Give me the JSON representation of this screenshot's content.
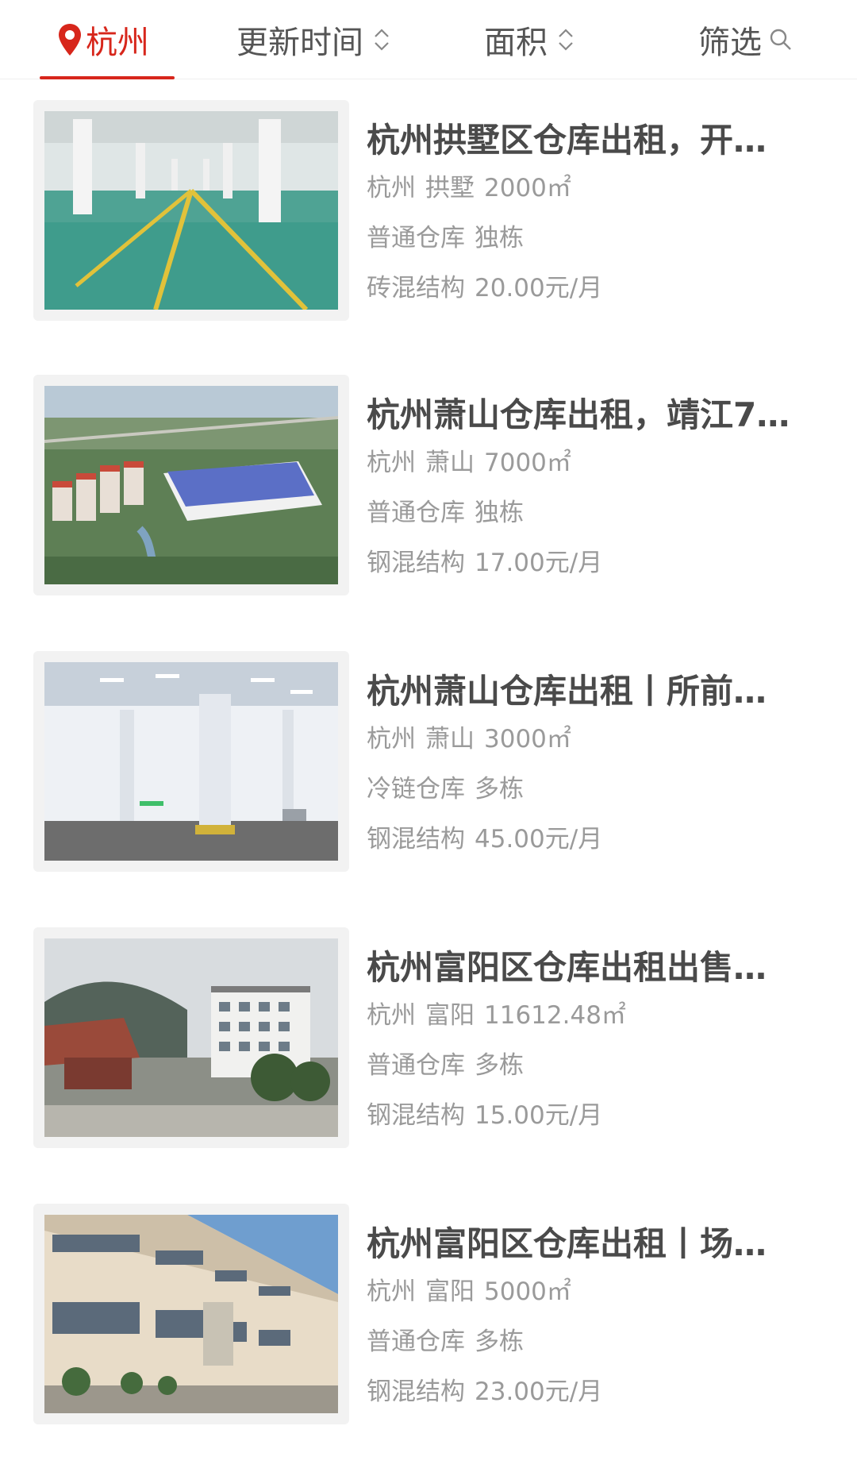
{
  "header": {
    "city": "杭州",
    "update_time": "更新时间",
    "area": "面积",
    "filter": "筛选"
  },
  "listings": [
    {
      "title": "杭州拱墅区仓库出租，开…",
      "city": "杭州",
      "district": "拱墅",
      "area": "2000㎡",
      "type": "普通仓库",
      "building": "独栋",
      "structure": "砖混结构",
      "price": "20.00元/月",
      "image": "warehouse-interior-green-floor"
    },
    {
      "title": "杭州萧山仓库出租，靖江7…",
      "city": "杭州",
      "district": "萧山",
      "area": "7000㎡",
      "type": "普通仓库",
      "building": "独栋",
      "structure": "钢混结构",
      "price": "17.00元/月",
      "image": "warehouse-aerial-rendering"
    },
    {
      "title": "杭州萧山仓库出租丨所前…",
      "city": "杭州",
      "district": "萧山",
      "area": "3000㎡",
      "type": "冷链仓库",
      "building": "多栋",
      "structure": "钢混结构",
      "price": "45.00元/月",
      "image": "cold-storage-interior"
    },
    {
      "title": "杭州富阳区仓库出租出售…",
      "city": "杭州",
      "district": "富阳",
      "area": "11612.48㎡",
      "type": "普通仓库",
      "building": "多栋",
      "structure": "钢混结构",
      "price": "15.00元/月",
      "image": "factory-gate-mountain"
    },
    {
      "title": "杭州富阳区仓库出租丨场…",
      "city": "杭州",
      "district": "富阳",
      "area": "5000㎡",
      "type": "普通仓库",
      "building": "多栋",
      "structure": "钢混结构",
      "price": "23.00元/月",
      "image": "factory-building-exterior"
    }
  ]
}
